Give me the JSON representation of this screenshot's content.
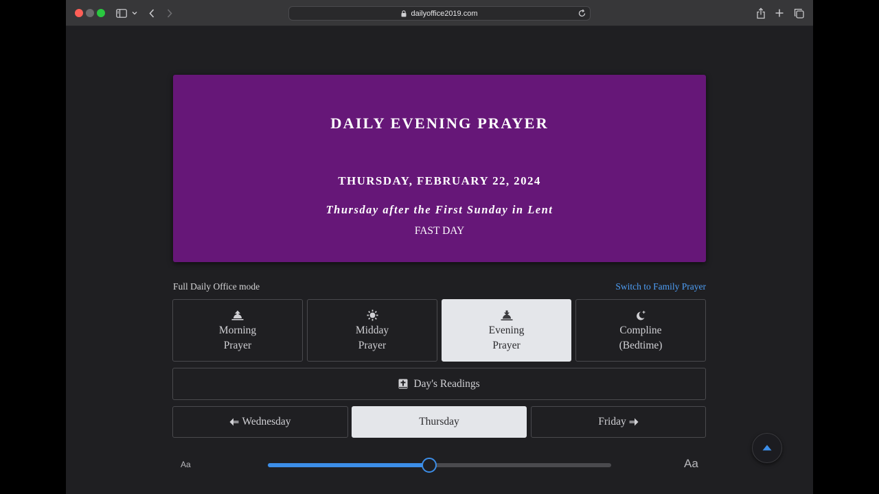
{
  "browser": {
    "url": "dailyoffice2019.com",
    "icons": {
      "sidebar": "sidebar-icon",
      "back": "chevron-left-icon",
      "forward": "chevron-right-icon",
      "lock": "lock-icon",
      "reload": "reload-icon",
      "share": "share-icon",
      "new_tab": "plus-icon",
      "tabs": "tabs-overview-icon"
    }
  },
  "hero": {
    "title": "DAILY EVENING PRAYER",
    "date": "THURSDAY, FEBRUARY 22, 2024",
    "subtitle": "Thursday after the First Sunday in Lent",
    "fast_label": "FAST DAY",
    "color": "#661778"
  },
  "mode": {
    "label": "Full Daily Office mode",
    "switch_link": "Switch to Family Prayer",
    "link_color": "#4e9ef5"
  },
  "offices": [
    {
      "line1": "Morning",
      "line2": "Prayer",
      "icon": "sunrise-icon",
      "active": false
    },
    {
      "line1": "Midday",
      "line2": "Prayer",
      "icon": "sun-icon",
      "active": false
    },
    {
      "line1": "Evening",
      "line2": "Prayer",
      "icon": "sunset-icon",
      "active": true
    },
    {
      "line1": "Compline",
      "line2": "(Bedtime)",
      "icon": "moon-icon",
      "active": false
    }
  ],
  "readings": {
    "label": "Day's Readings",
    "icon": "bible-icon"
  },
  "days": {
    "prev": "Wednesday",
    "current": "Thursday",
    "next": "Friday"
  },
  "font_size": {
    "small_label": "Aa",
    "large_label": "Aa",
    "level": 0.47,
    "accent": "#3c8ee8"
  },
  "scroll_top": {
    "icon": "arrow-up-icon"
  }
}
